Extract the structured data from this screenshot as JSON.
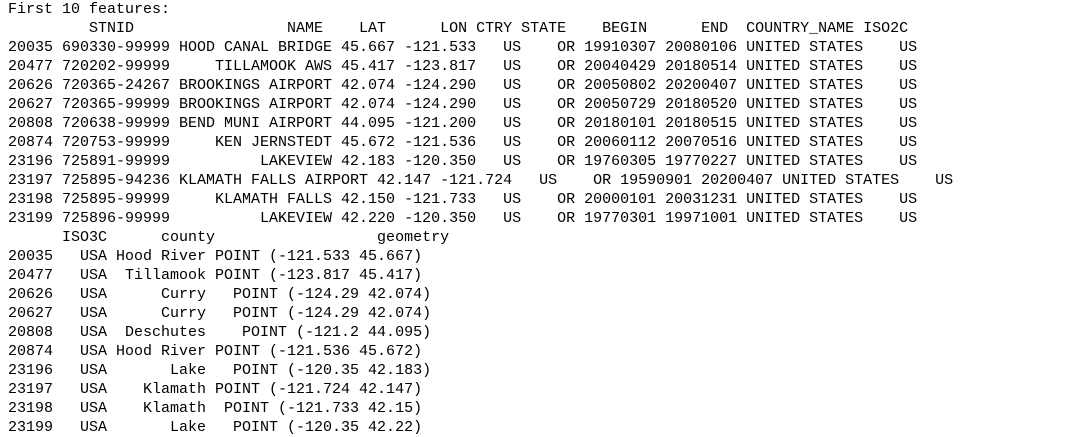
{
  "console": {
    "lines": [
      "First 10 features:",
      "         STNID                 NAME    LAT      LON CTRY STATE    BEGIN      END  COUNTRY_NAME ISO2C",
      "20035 690330-99999 HOOD CANAL BRIDGE 45.667 -121.533   US    OR 19910307 20080106 UNITED STATES    US",
      "20477 720202-99999     TILLAMOOK AWS 45.417 -123.817   US    OR 20040429 20180514 UNITED STATES    US",
      "20626 720365-24267 BROOKINGS AIRPORT 42.074 -124.290   US    OR 20050802 20200407 UNITED STATES    US",
      "20627 720365-99999 BROOKINGS AIRPORT 42.074 -124.290   US    OR 20050729 20180520 UNITED STATES    US",
      "20808 720638-99999 BEND MUNI AIRPORT 44.095 -121.200   US    OR 20180101 20180515 UNITED STATES    US",
      "20874 720753-99999     KEN JERNSTEDT 45.672 -121.536   US    OR 20060112 20070516 UNITED STATES    US",
      "23196 725891-99999          LAKEVIEW 42.183 -120.350   US    OR 19760305 19770227 UNITED STATES    US",
      "23197 725895-94236 KLAMATH FALLS AIRPORT 42.147 -121.724   US    OR 19590901 20200407 UNITED STATES    US",
      "23198 725895-99999     KLAMATH FALLS 42.150 -121.733   US    OR 20000101 20031231 UNITED STATES    US",
      "23199 725896-99999          LAKEVIEW 42.220 -120.350   US    OR 19770301 19971001 UNITED STATES    US",
      "      ISO3C      county                  geometry",
      "20035   USA Hood River POINT (-121.533 45.667)",
      "20477   USA  Tillamook POINT (-123.817 45.417)",
      "20626   USA      Curry   POINT (-124.29 42.074)",
      "20627   USA      Curry   POINT (-124.29 42.074)",
      "20808   USA  Deschutes    POINT (-121.2 44.095)",
      "20874   USA Hood River POINT (-121.536 45.672)",
      "23196   USA       Lake   POINT (-120.35 42.183)",
      "23197   USA    Klamath POINT (-121.724 42.147)",
      "23198   USA    Klamath  POINT (-121.733 42.15)",
      "23199   USA       Lake   POINT (-120.35 42.22)"
    ]
  }
}
